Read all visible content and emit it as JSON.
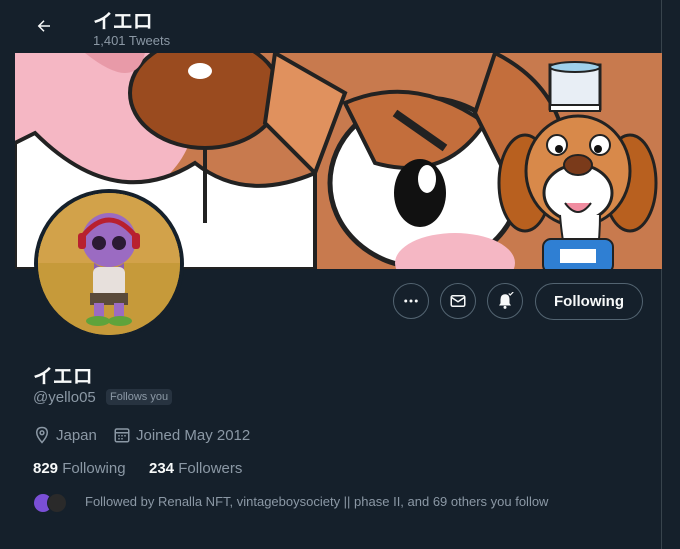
{
  "header": {
    "title": "イエロ",
    "subtitle": "1,401 Tweets"
  },
  "profile": {
    "name": "イエロ",
    "handle": "@yello05",
    "follows_you": "Follows you",
    "location": "Japan",
    "joined": "Joined May 2012",
    "following_count": "829",
    "following_label": "Following",
    "followers_count": "234",
    "followers_label": "Followers",
    "followed_by": "Followed by Renalla NFT, vintageboysociety || phase II, and 69 others you follow"
  },
  "actions": {
    "follow_label": "Following"
  },
  "icons": {
    "back": "arrow-left-icon",
    "more": "more-icon",
    "message": "envelope-icon",
    "notify": "bell-icon",
    "location": "location-pin-icon",
    "calendar": "calendar-icon"
  },
  "colors": {
    "background": "#15202b",
    "text": "#f7f9f9",
    "muted": "#8b98a5",
    "border": "#536471"
  }
}
